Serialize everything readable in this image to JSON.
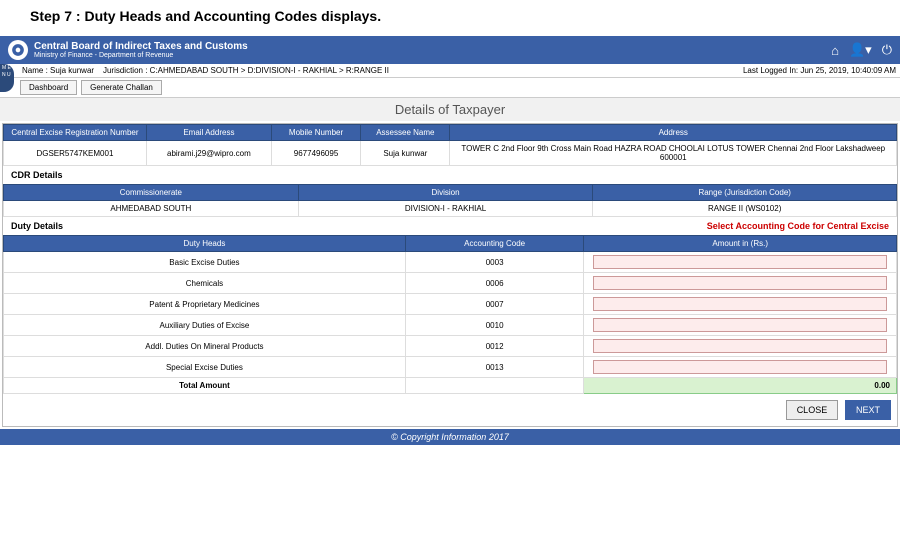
{
  "step_title": "Step 7 :  Duty Heads and Accounting Codes displays.",
  "header": {
    "org_line1": "Central Board of Indirect Taxes and Customs",
    "org_line2": "Ministry of Finance - Department of Revenue"
  },
  "user_info": {
    "name_label": "Name :",
    "name": "Suja kunwar",
    "jur_label": "Jurisdiction :",
    "jurisdiction": "C:AHMEDABAD SOUTH > D:DIVISION-I - RAKHIAL > R:RANGE II",
    "last_login_label": "Last Logged In:",
    "last_login": "Jun 25, 2019, 10:40:09 AM"
  },
  "menu_label": "M\nE\nN\nU",
  "tabs": {
    "dashboard": "Dashboard",
    "generate": "Generate Challan"
  },
  "section_title": "Details of Taxpayer",
  "taxpayer": {
    "headers": {
      "reg": "Central Excise Registration Number",
      "email": "Email Address",
      "mobile": "Mobile Number",
      "assessee": "Assessee Name",
      "address": "Address"
    },
    "row": {
      "reg": "DGSER5747KEM001",
      "email": "abirami.j29@wipro.com",
      "mobile": "9677496095",
      "assessee": "Suja kunwar",
      "address": "TOWER C 2nd Floor 9th Cross Main Road HAZRA ROAD CHOOLAI LOTUS TOWER Chennai 2nd Floor Lakshadweep 600001"
    }
  },
  "cdr": {
    "title": "CDR Details",
    "headers": {
      "comm": "Commissionerate",
      "div": "Division",
      "range": "Range (Jurisdiction Code)"
    },
    "row": {
      "comm": "AHMEDABAD SOUTH",
      "div": "DIVISION-I - RAKHIAL",
      "range": "RANGE II (WS0102)"
    }
  },
  "duty": {
    "title": "Duty Details",
    "select_hint": "Select Accounting Code for Central Excise",
    "headers": {
      "head": "Duty Heads",
      "code": "Accounting Code",
      "amount": "Amount in (Rs.)"
    },
    "rows": [
      {
        "head": "Basic Excise Duties",
        "code": "0003"
      },
      {
        "head": "Chemicals",
        "code": "0006"
      },
      {
        "head": "Patent & Proprietary Medicines",
        "code": "0007"
      },
      {
        "head": "Auxiliary Duties of Excise",
        "code": "0010"
      },
      {
        "head": "Addl. Duties On Mineral Products",
        "code": "0012"
      },
      {
        "head": "Special Excise Duties",
        "code": "0013"
      }
    ],
    "total_label": "Total Amount",
    "total_value": "0.00"
  },
  "buttons": {
    "close": "CLOSE",
    "next": "NEXT"
  },
  "footer": "© Copyright Information 2017"
}
